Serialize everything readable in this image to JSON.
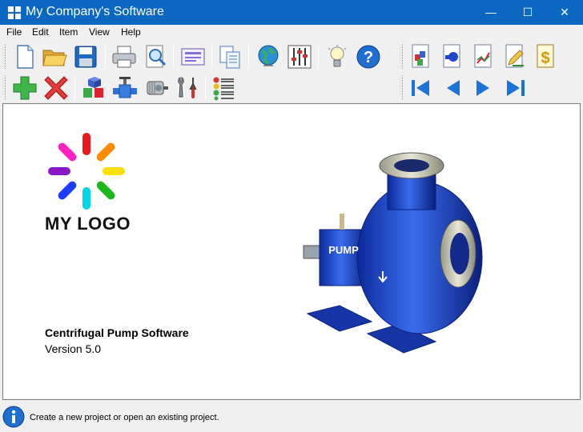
{
  "window": {
    "title": "My Company's Software",
    "minimize_glyph": "—",
    "maximize_glyph": "☐",
    "close_glyph": "✕",
    "titlebar_color": "#0b68c2"
  },
  "menu": {
    "items": [
      "File",
      "Edit",
      "Item",
      "View",
      "Help"
    ]
  },
  "toolbar": {
    "row1_icons": [
      "new-document-icon",
      "open-folder-icon",
      "save-disk-icon",
      "print-icon",
      "print-preview-icon",
      "form-icon",
      "copy-icon",
      "globe-icon",
      "mixer-sliders-icon",
      "lightbulb-icon",
      "help-icon"
    ],
    "row1_right_icons": [
      "report-3d-icon",
      "report-pump-icon",
      "report-chart-icon",
      "report-edit-icon",
      "report-cost-icon"
    ],
    "row2_icons": [
      "add-icon",
      "delete-icon",
      "blocks-icon",
      "valve-icon",
      "motor-icon",
      "tools-icon",
      "checklist-icon"
    ],
    "nav_icons": [
      "first-icon",
      "previous-icon",
      "next-icon",
      "last-icon"
    ],
    "nav_color": "#1a73d9"
  },
  "content": {
    "logo_text": "MY LOGO",
    "product_name": "Centrifugal Pump Software",
    "product_version": "Version 5.0",
    "pump_label": "PUMP",
    "pump_color": "#1f45c8"
  },
  "status": {
    "text": "Create a new project or open an existing project.",
    "icon": "info-icon"
  }
}
